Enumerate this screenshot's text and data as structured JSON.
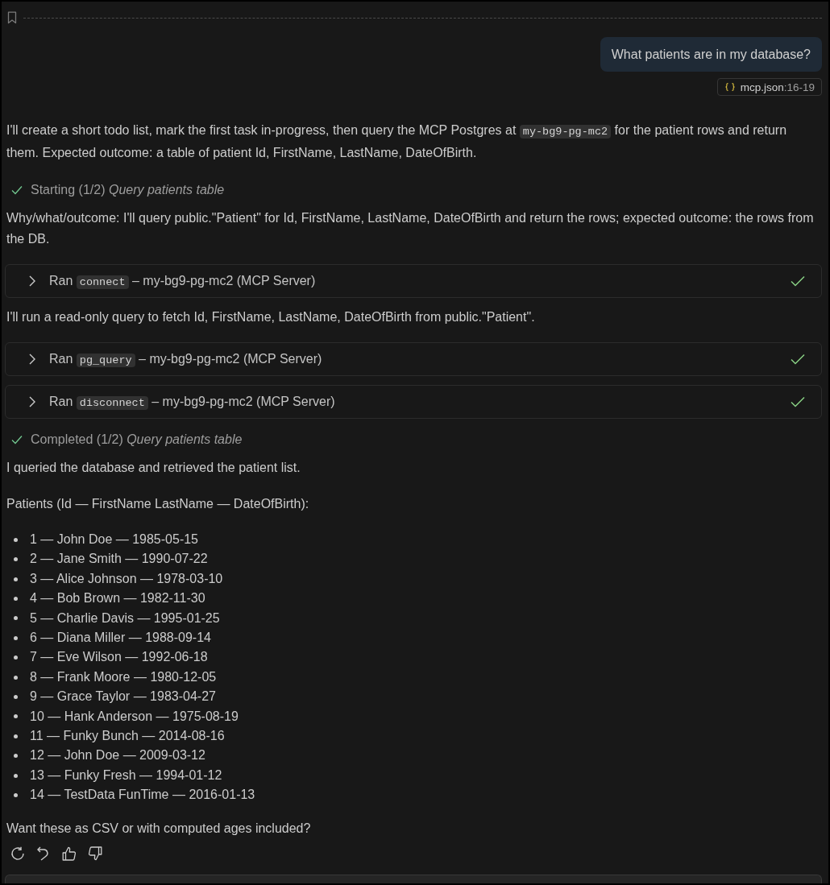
{
  "user_message": {
    "text": "What patients are in my database?",
    "reference": {
      "file": "mcp.json",
      "range": ":16-19"
    }
  },
  "response": [
    {
      "kind": "paragraph",
      "parts": [
        {
          "kind": "text",
          "text": "I'll create a short todo list, mark the first task in-progress, then query the MCP Postgres at "
        },
        {
          "kind": "code",
          "text": "my-bg9-pg-mc2"
        },
        {
          "kind": "text",
          "text": " for the patient rows and return them. Expected outcome: a table of patient Id, FirstName, LastName, DateOfBirth."
        }
      ]
    },
    {
      "kind": "progress",
      "done": true,
      "status": "Starting (1/2)",
      "task": "Query patients table"
    },
    {
      "kind": "paragraph",
      "parts": [
        {
          "kind": "text",
          "text": "Why/what/outcome: I'll query public.\"Patient\" for Id, FirstName, LastName, DateOfBirth and return the rows; expected outcome: the rows from the DB."
        }
      ]
    },
    {
      "kind": "tool",
      "expanded": false,
      "done": true,
      "verb": "Ran",
      "tool": "connect",
      "detail": "– my-bg9-pg-mc2 (MCP Server)"
    },
    {
      "kind": "paragraph",
      "parts": [
        {
          "kind": "text",
          "text": "I'll run a read-only query to fetch Id, FirstName, LastName, DateOfBirth from public.\"Patient\"."
        }
      ]
    },
    {
      "kind": "tool",
      "expanded": false,
      "done": true,
      "verb": "Ran",
      "tool": "pg_query",
      "detail": "– my-bg9-pg-mc2 (MCP Server)"
    },
    {
      "kind": "tool",
      "expanded": false,
      "done": true,
      "verb": "Ran",
      "tool": "disconnect",
      "detail": "– my-bg9-pg-mc2 (MCP Server)"
    },
    {
      "kind": "progress",
      "done": true,
      "status": "Completed (1/2)",
      "task": "Query patients table"
    },
    {
      "kind": "paragraph",
      "parts": [
        {
          "kind": "text",
          "text": "I queried the database and retrieved the patient list."
        }
      ]
    },
    {
      "kind": "paragraph",
      "parts": [
        {
          "kind": "text",
          "text": "Patients (Id — FirstName LastName — DateOfBirth):"
        }
      ]
    },
    {
      "kind": "list",
      "items": [
        "1 — John Doe — 1985-05-15",
        "2 — Jane Smith — 1990-07-22",
        "3 — Alice Johnson — 1978-03-10",
        "4 — Bob Brown — 1982-11-30",
        "5 — Charlie Davis — 1995-01-25",
        "6 — Diana Miller — 1988-09-14",
        "7 — Eve Wilson — 1992-06-18",
        "8 — Frank Moore — 1980-12-05",
        "9 — Grace Taylor — 1983-04-27",
        "10 — Hank Anderson — 1975-08-19",
        "11 — Funky Bunch — 2014-08-16",
        "12 — John Doe — 2009-03-12",
        "13 — Funky Fresh — 1994-01-12",
        "14 — TestData FunTime — 2016-01-13"
      ]
    },
    {
      "kind": "paragraph",
      "parts": [
        {
          "kind": "text",
          "text": "Want these as CSV or with computed ages included?"
        }
      ]
    }
  ]
}
